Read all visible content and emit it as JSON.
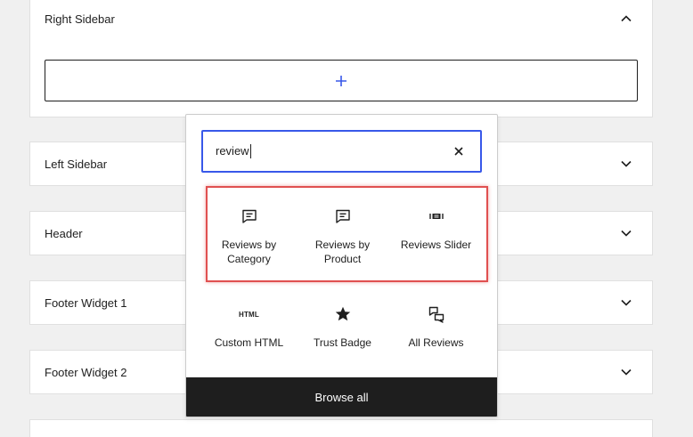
{
  "panels": {
    "right_sidebar": "Right Sidebar",
    "left_sidebar": "Left Sidebar",
    "header": "Header",
    "footer_widget_1": "Footer Widget 1",
    "footer_widget_2": "Footer Widget 2"
  },
  "inserter": {
    "search_value": "review",
    "results": [
      {
        "label": "Reviews by Category",
        "icon": "comment-icon"
      },
      {
        "label": "Reviews by Product",
        "icon": "comment-icon"
      },
      {
        "label": "Reviews Slider",
        "icon": "slider-icon"
      }
    ],
    "more": [
      {
        "label": "Custom HTML",
        "icon": "html-icon",
        "icon_text": "HTML"
      },
      {
        "label": "Trust Badge",
        "icon": "star-icon"
      },
      {
        "label": "All Reviews",
        "icon": "comments-icon"
      }
    ],
    "browse_all_label": "Browse all"
  },
  "colors": {
    "accent": "#3858e9",
    "highlight": "#e05050",
    "dark": "#1e1e1e",
    "background": "#f0f0f0"
  }
}
